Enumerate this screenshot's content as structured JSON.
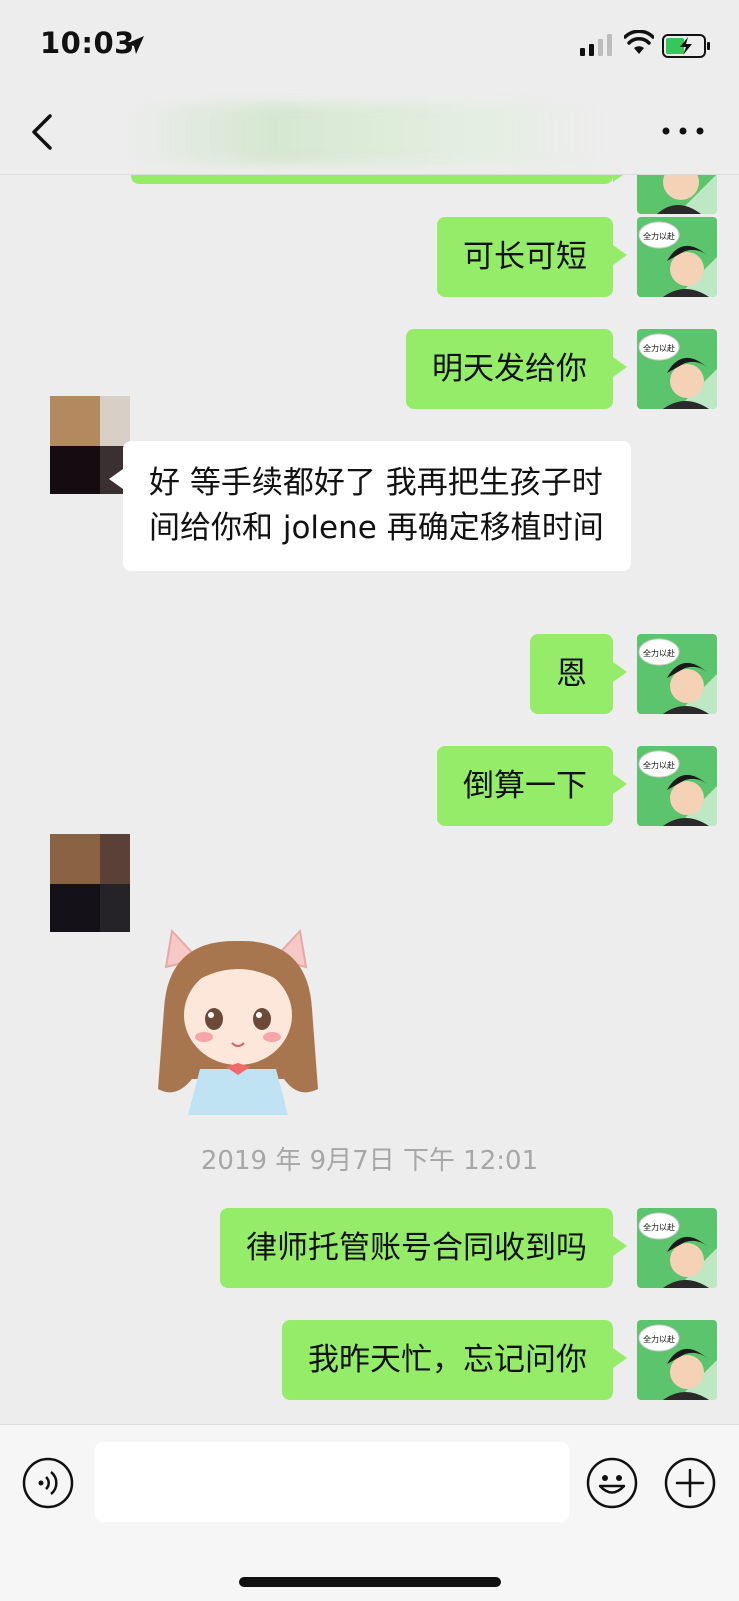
{
  "status_bar": {
    "time": "10:03"
  },
  "nav": {
    "title": ""
  },
  "messages": [
    {
      "side": "right",
      "text": ""
    },
    {
      "side": "right",
      "text": "可长可短"
    },
    {
      "side": "right",
      "text": "明天发给你"
    },
    {
      "side": "left",
      "text": "好 等手续都好了 我再把生孩子时间给你和 jolene 再确定移植时间"
    },
    {
      "side": "right",
      "text": "恩"
    },
    {
      "side": "right",
      "text": "倒算一下"
    },
    {
      "side": "left",
      "type": "sticker"
    },
    {
      "side": "right",
      "text": "律师托管账号合同收到吗"
    },
    {
      "side": "right",
      "text": "我昨天忙，忘记问你"
    }
  ],
  "timestamp": "2019 年 9月7日 下午 12:01",
  "my_avatar": {
    "caption": "全力以赴"
  },
  "input": {
    "placeholder": ""
  },
  "colors": {
    "bubble_green": "#95ec69",
    "background": "#ededed",
    "avatar_green": "#5cc46d"
  }
}
